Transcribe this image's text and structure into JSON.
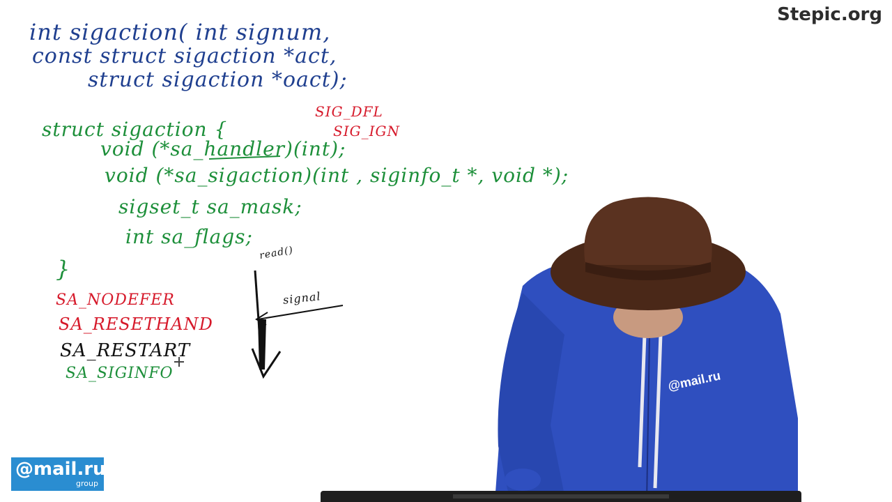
{
  "watermark": "Stepic.org",
  "logo": {
    "main": "@mail.ru",
    "sub": "group"
  },
  "presenter_logo": "@mail.ru",
  "prototype": {
    "line1": "int sigaction( int signum,",
    "line2": "const struct sigaction *act,",
    "line3": "struct sigaction *oact);"
  },
  "struct": {
    "open": "struct sigaction {",
    "handler": "void (*sa_handler)(int);",
    "sigaction": "void (*sa_sigaction)(int , siginfo_t *, void *);",
    "mask": "sigset_t sa_mask;",
    "flags": "int sa_flags;",
    "close": "}"
  },
  "constants": {
    "dfl": "SIG_DFL",
    "ign": "SIG_IGN"
  },
  "flags_list": {
    "nodefer": "SA_NODEFER",
    "resethand": "SA_RESETHAND",
    "restart": "SA_RESTART",
    "siginfo": "SA_SIGINFO"
  },
  "diagram": {
    "read": "read()",
    "signal": "signal"
  },
  "colors": {
    "ink_blue": "#1f3f8f",
    "ink_green": "#1d8f3a",
    "ink_red": "#d6192a",
    "ink_black": "#111111",
    "logo_blue": "#2a8dd1",
    "hoodie_blue": "#2f4fbf",
    "hat_brown": "#4a2818"
  }
}
